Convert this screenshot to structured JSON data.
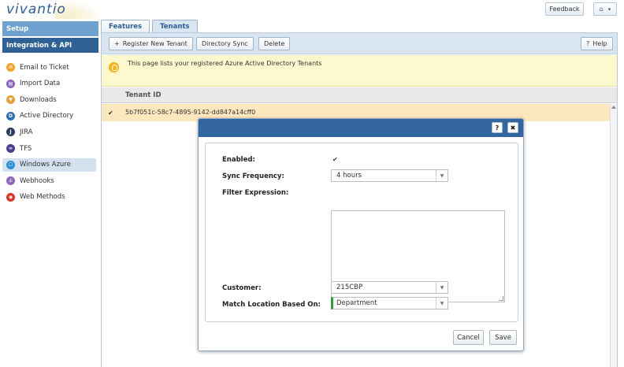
{
  "header": {
    "logo": "vivantio",
    "feedback_label": "Feedback",
    "user_icon_glyph": "⌂",
    "user_menu_glyph": "▾"
  },
  "sidebar": {
    "setup_label": "Setup",
    "section_label": "Integration & API",
    "items": [
      {
        "label": "Email to Ticket",
        "icon": "email-icon",
        "color": "#f0a430",
        "glyph": "✉"
      },
      {
        "label": "Import Data",
        "icon": "import-icon",
        "color": "#8a67b8",
        "glyph": "▤"
      },
      {
        "label": "Downloads",
        "icon": "downloads-icon",
        "color": "#e0a23a",
        "glyph": "▼"
      },
      {
        "label": "Active Directory",
        "icon": "active-directory-icon",
        "color": "#2f6fb5",
        "glyph": "D"
      },
      {
        "label": "JIRA",
        "icon": "jira-icon",
        "color": "#2b3f5f",
        "glyph": "J"
      },
      {
        "label": "TFS",
        "icon": "tfs-icon",
        "color": "#4b3f8f",
        "glyph": "∞"
      },
      {
        "label": "Windows Azure",
        "icon": "windows-azure-icon",
        "color": "#2c8fd6",
        "glyph": "☐"
      },
      {
        "label": "Webhooks",
        "icon": "webhooks-icon",
        "color": "#8a67b8",
        "glyph": "⚓"
      },
      {
        "label": "Web Methods",
        "icon": "web-methods-icon",
        "color": "#d9342b",
        "glyph": "◉"
      }
    ],
    "active_index": 6
  },
  "tabs": [
    {
      "label": "Features"
    },
    {
      "label": "Tenants"
    }
  ],
  "toolbar": {
    "register_label": "Register New Tenant",
    "register_glyph": "+",
    "sync_label": "Directory Sync",
    "delete_label": "Delete",
    "help_label": "Help",
    "help_glyph": "?"
  },
  "info": {
    "text": "This page lists your registered Azure Active Directory Tenants"
  },
  "table": {
    "column_header": "Tenant ID",
    "rows": [
      {
        "tenant_id": "5b7f051c-58c7-4895-9142-dd847a14cff0",
        "checked_glyph": "✔"
      }
    ]
  },
  "modal": {
    "help_glyph": "?",
    "close_glyph": "✖",
    "enabled_label": "Enabled:",
    "enabled_glyph": "✔",
    "sync_frequency_label": "Sync Frequency:",
    "sync_frequency_value": "4 hours",
    "filter_expression_label": "Filter Expression:",
    "filter_expression_value": "",
    "customer_label": "Customer:",
    "customer_value": "215CBP",
    "match_location_label": "Match Location Based On:",
    "match_location_value": "Department",
    "cancel_label": "Cancel",
    "save_label": "Save",
    "arrow_glyph": "▼"
  }
}
